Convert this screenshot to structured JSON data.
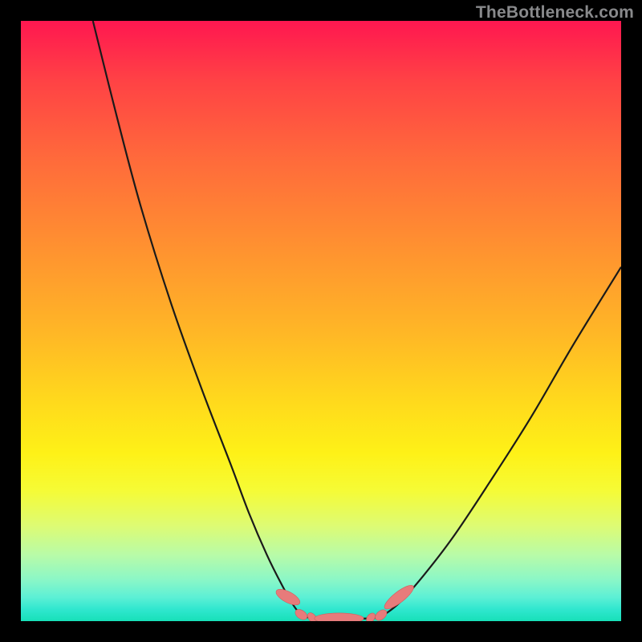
{
  "watermark": "TheBottleneck.com",
  "colors": {
    "frame": "#000000",
    "curve": "#1a1a1a",
    "marker_fill": "#e77b7b",
    "marker_stroke": "#d35c5c",
    "gradient_top": "#ff1750",
    "gradient_bottom": "#17e0b8"
  },
  "chart_data": {
    "type": "line",
    "title": "",
    "xlabel": "",
    "ylabel": "",
    "xlim": [
      0,
      100
    ],
    "ylim": [
      0,
      100
    ],
    "series": [
      {
        "name": "left-branch",
        "x": [
          12,
          16,
          20,
          25,
          30,
          35,
          38,
          41,
          43.5,
          45.5,
          47
        ],
        "y": [
          100,
          84,
          69,
          53,
          39,
          26,
          18,
          11,
          6,
          2.5,
          0.7
        ]
      },
      {
        "name": "flat",
        "x": [
          47,
          50,
          54,
          58,
          60
        ],
        "y": [
          0.7,
          0.45,
          0.45,
          0.45,
          0.7
        ]
      },
      {
        "name": "right-branch",
        "x": [
          60,
          63,
          67,
          72,
          78,
          85,
          92,
          100
        ],
        "y": [
          0.7,
          3,
          7.5,
          14,
          23,
          34,
          46,
          59
        ]
      }
    ],
    "markers": [
      {
        "cx": 44.5,
        "cy": 4.0,
        "rx": 0.9,
        "ry": 2.2,
        "angle": -62
      },
      {
        "cx": 46.7,
        "cy": 1.1,
        "rx": 0.7,
        "ry": 1.1,
        "angle": -55
      },
      {
        "cx": 48.5,
        "cy": 0.6,
        "rx": 0.6,
        "ry": 0.9,
        "angle": -40
      },
      {
        "cx": 53.0,
        "cy": 0.45,
        "rx": 0.9,
        "ry": 4.1,
        "angle": 90
      },
      {
        "cx": 58.3,
        "cy": 0.55,
        "rx": 0.6,
        "ry": 0.9,
        "angle": 40
      },
      {
        "cx": 60.0,
        "cy": 1.0,
        "rx": 0.7,
        "ry": 1.1,
        "angle": 50
      },
      {
        "cx": 63.0,
        "cy": 4.0,
        "rx": 0.9,
        "ry": 3.0,
        "angle": 52
      }
    ]
  }
}
